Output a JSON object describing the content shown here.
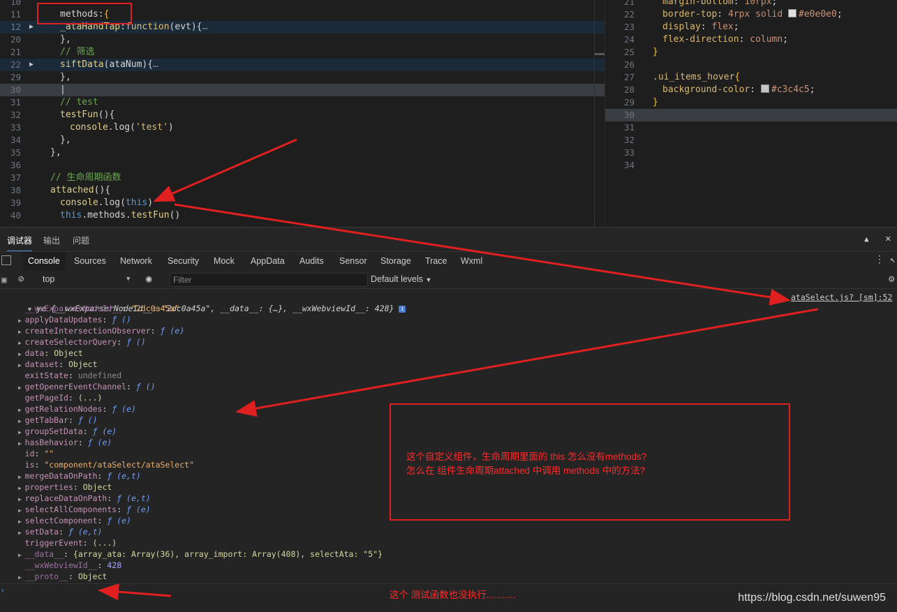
{
  "editor_left": {
    "lines": [
      {
        "n": "10",
        "text": ""
      },
      {
        "n": "11",
        "tokens": [
          [
            "methods",
            ""
          ],
          [
            ":",
            ""
          ],
          [
            "{",
            "brace"
          ]
        ]
      },
      {
        "n": "12",
        "fold": true,
        "tokens": [
          [
            "_ataHandTap",
            "fn"
          ],
          [
            ":",
            ""
          ],
          [
            "function",
            "kw"
          ],
          [
            "(evt){",
            ""
          ],
          [
            "…",
            "und"
          ]
        ]
      },
      {
        "n": "20",
        "tokens": [
          [
            "},",
            ""
          ]
        ]
      },
      {
        "n": "21",
        "tokens": [
          [
            "// 筛选",
            "cm"
          ]
        ]
      },
      {
        "n": "22",
        "fold": true,
        "tokens": [
          [
            "siftData",
            "fn"
          ],
          [
            "(ataNum){",
            ""
          ],
          [
            "…",
            "und"
          ]
        ]
      },
      {
        "n": "29",
        "tokens": [
          [
            "},",
            ""
          ]
        ]
      },
      {
        "n": "30",
        "tokens": [
          [
            "|",
            ""
          ]
        ]
      },
      {
        "n": "31",
        "tokens": [
          [
            "// test",
            "cm"
          ]
        ]
      },
      {
        "n": "32",
        "tokens": [
          [
            "testFun",
            "fn"
          ],
          [
            "(){",
            ""
          ]
        ]
      },
      {
        "n": "33",
        "tokens": [
          [
            "console",
            "fn"
          ],
          [
            ".log(",
            ""
          ],
          [
            "'test'",
            "str"
          ],
          [
            ")",
            ""
          ]
        ]
      },
      {
        "n": "34",
        "tokens": [
          [
            "},",
            ""
          ]
        ]
      },
      {
        "n": "35",
        "tokens": [
          [
            "},",
            ""
          ]
        ]
      },
      {
        "n": "36",
        "tokens": [
          [
            "",
            ""
          ]
        ]
      },
      {
        "n": "37",
        "tokens": [
          [
            "// 生命周期函数",
            "cm"
          ]
        ]
      },
      {
        "n": "38",
        "tokens": [
          [
            "attached",
            "fn"
          ],
          [
            "(){",
            ""
          ]
        ]
      },
      {
        "n": "39",
        "tokens": [
          [
            "console",
            "fn"
          ],
          [
            ".log(",
            ""
          ],
          [
            "this",
            "tw"
          ],
          [
            ")",
            ""
          ]
        ]
      },
      {
        "n": "40",
        "tokens": [
          [
            "this",
            "tw"
          ],
          [
            ".methods.",
            ""
          ],
          [
            "testFun",
            "fn"
          ],
          [
            "()",
            ""
          ]
        ]
      }
    ]
  },
  "editor_right": {
    "lines": [
      {
        "n": "21",
        "tokens": [
          [
            "margin-bottom",
            "pr"
          ],
          [
            ": ",
            ""
          ],
          [
            "10rpx",
            "num"
          ],
          [
            ";",
            ""
          ]
        ]
      },
      {
        "n": "22",
        "tokens": [
          [
            "border-top",
            "pr"
          ],
          [
            ": ",
            ""
          ],
          [
            "4rpx solid ",
            "num"
          ],
          [
            "#swatch-e0e0e0",
            ""
          ],
          [
            "#e0e0e0",
            "val"
          ],
          [
            ";",
            ""
          ]
        ]
      },
      {
        "n": "23",
        "tokens": [
          [
            "display",
            "pr"
          ],
          [
            ": ",
            ""
          ],
          [
            "flex",
            "val"
          ],
          [
            ";",
            ""
          ]
        ]
      },
      {
        "n": "24",
        "tokens": [
          [
            "flex-direction",
            "pr"
          ],
          [
            ": ",
            ""
          ],
          [
            "column",
            "val"
          ],
          [
            ";",
            ""
          ]
        ]
      },
      {
        "n": "25",
        "tokens": [
          [
            "}",
            "brace"
          ]
        ]
      },
      {
        "n": "26",
        "tokens": []
      },
      {
        "n": "27",
        "tokens": [
          [
            ".ui_items_hover",
            "sel"
          ],
          [
            "{",
            "brace"
          ]
        ]
      },
      {
        "n": "28",
        "tokens": [
          [
            "background-color",
            "pr"
          ],
          [
            ": ",
            ""
          ],
          [
            "#swatch-c3c4c5",
            ""
          ],
          [
            "#c3c4c5",
            "val"
          ],
          [
            ";",
            ""
          ]
        ]
      },
      {
        "n": "29",
        "tokens": [
          [
            "}",
            "brace"
          ]
        ]
      },
      {
        "n": "30",
        "tokens": []
      },
      {
        "n": "31",
        "tokens": []
      },
      {
        "n": "32",
        "tokens": []
      },
      {
        "n": "33",
        "tokens": []
      },
      {
        "n": "34",
        "tokens": []
      }
    ],
    "swatches": {
      "e0e0e0": "#e0e0e0",
      "c3c4c5": "#c3c4c5"
    }
  },
  "devtools": {
    "top_tabs": [
      "调试器",
      "输出",
      "问题"
    ],
    "panel_tabs": [
      "Console",
      "Sources",
      "Network",
      "Security",
      "Mock",
      "AppData",
      "Audits",
      "Sensor",
      "Storage",
      "Trace",
      "Wxml"
    ],
    "context": "top",
    "filter_placeholder": "Filter",
    "levels": "Default levels"
  },
  "console": {
    "source_link": "ataSelect.js? [sm]:52",
    "header": {
      "name": "ye",
      "body": "{__wxExparserNodeId__: \"2dc0a45a\", __data__: {…}, __wxWebviewId__: 428}"
    },
    "rows": [
      {
        "exp": false,
        "key": "__wxExparserNodeId__",
        "dim": true,
        "val": "\"2dc0a45a\"",
        "t": "strv"
      },
      {
        "exp": true,
        "key": "applyDataUpdates",
        "val": "ƒ ()",
        "t": "f"
      },
      {
        "exp": true,
        "key": "createIntersectionObserver",
        "val": "ƒ (e)",
        "t": "f"
      },
      {
        "exp": true,
        "key": "createSelectorQuery",
        "val": "ƒ ()",
        "t": "f"
      },
      {
        "exp": true,
        "key": "data",
        "val": "Object",
        "t": "sv"
      },
      {
        "exp": true,
        "key": "dataset",
        "val": "Object",
        "t": "sv"
      },
      {
        "exp": false,
        "key": "exitState",
        "val": "undefined",
        "t": "und"
      },
      {
        "exp": true,
        "key": "getOpenerEventChannel",
        "val": "ƒ ()",
        "t": "f"
      },
      {
        "exp": false,
        "key": "getPageId",
        "val": "(...)",
        "t": "sv"
      },
      {
        "exp": true,
        "key": "getRelationNodes",
        "val": "ƒ (e)",
        "t": "f"
      },
      {
        "exp": true,
        "key": "getTabBar",
        "val": "ƒ ()",
        "t": "f"
      },
      {
        "exp": true,
        "key": "groupSetData",
        "val": "ƒ (e)",
        "t": "f"
      },
      {
        "exp": true,
        "key": "hasBehavior",
        "val": "ƒ (e)",
        "t": "f"
      },
      {
        "exp": false,
        "key": "id",
        "val": "\"\"",
        "t": "strv"
      },
      {
        "exp": false,
        "key": "is",
        "val": "\"component/ataSelect/ataSelect\"",
        "t": "strv"
      },
      {
        "exp": true,
        "key": "mergeDataOnPath",
        "val": "ƒ (e,t)",
        "t": "f"
      },
      {
        "exp": true,
        "key": "properties",
        "val": "Object",
        "t": "sv"
      },
      {
        "exp": true,
        "key": "replaceDataOnPath",
        "val": "ƒ (e,t)",
        "t": "f"
      },
      {
        "exp": true,
        "key": "selectAllComponents",
        "val": "ƒ (e)",
        "t": "f"
      },
      {
        "exp": true,
        "key": "selectComponent",
        "val": "ƒ (e)",
        "t": "f"
      },
      {
        "exp": true,
        "key": "setData",
        "val": "ƒ (e,t)",
        "t": "f"
      },
      {
        "exp": false,
        "key": "triggerEvent",
        "val": "(...)",
        "t": "sv"
      },
      {
        "exp": true,
        "key": "__data__",
        "dim": true,
        "val": "{array_ata: Array(36), array_import: Array(408), selectAta: \"5\"}",
        "t": "sv"
      },
      {
        "exp": false,
        "key": "__wxWebviewId__",
        "dim": true,
        "val": "428",
        "t": "numv"
      },
      {
        "exp": true,
        "key": "__proto__",
        "dim": true,
        "val": "Object",
        "t": "sv"
      }
    ]
  },
  "annotations": {
    "question_line1": "这个自定义组件，生命周期里面的 this 怎么没有methods?",
    "question_line2": "怎么在 组件生命周期attached 中调用 methods 中的方法?",
    "bottom_note": "这个 测试函数也没执行...........",
    "color": "#e02020"
  },
  "watermark": "https://blog.csdn.net/suwen95"
}
